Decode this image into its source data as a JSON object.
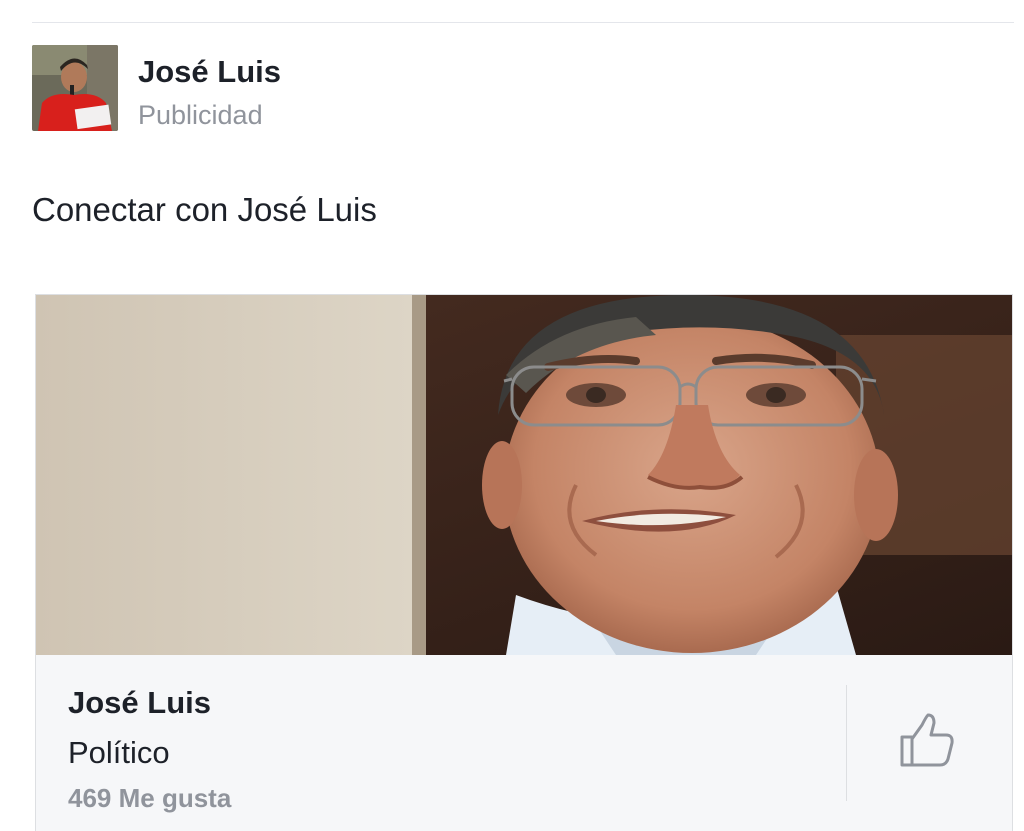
{
  "post": {
    "author_name": "José Luis",
    "sponsored_label": "Publicidad",
    "text": "Conectar con José Luis"
  },
  "ad_card": {
    "page_name": "José Luis",
    "category": "Político",
    "likes": "469 Me gusta",
    "like_icon": "thumbs-up-icon"
  },
  "colors": {
    "text_primary": "#1d2129",
    "text_secondary": "#90949c",
    "card_background": "#f6f7f9",
    "divider": "#dddfe2"
  }
}
